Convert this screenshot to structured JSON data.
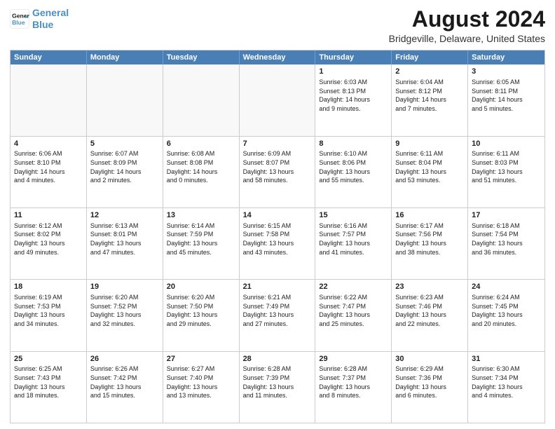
{
  "header": {
    "logo_line1": "General",
    "logo_line2": "Blue",
    "main_title": "August 2024",
    "subtitle": "Bridgeville, Delaware, United States"
  },
  "calendar": {
    "days": [
      "Sunday",
      "Monday",
      "Tuesday",
      "Wednesday",
      "Thursday",
      "Friday",
      "Saturday"
    ],
    "weeks": [
      [
        {
          "day": "",
          "info": "",
          "empty": true
        },
        {
          "day": "",
          "info": "",
          "empty": true
        },
        {
          "day": "",
          "info": "",
          "empty": true
        },
        {
          "day": "",
          "info": "",
          "empty": true
        },
        {
          "day": "1",
          "info": "Sunrise: 6:03 AM\nSunset: 8:13 PM\nDaylight: 14 hours\nand 9 minutes.",
          "empty": false
        },
        {
          "day": "2",
          "info": "Sunrise: 6:04 AM\nSunset: 8:12 PM\nDaylight: 14 hours\nand 7 minutes.",
          "empty": false
        },
        {
          "day": "3",
          "info": "Sunrise: 6:05 AM\nSunset: 8:11 PM\nDaylight: 14 hours\nand 5 minutes.",
          "empty": false
        }
      ],
      [
        {
          "day": "4",
          "info": "Sunrise: 6:06 AM\nSunset: 8:10 PM\nDaylight: 14 hours\nand 4 minutes.",
          "empty": false
        },
        {
          "day": "5",
          "info": "Sunrise: 6:07 AM\nSunset: 8:09 PM\nDaylight: 14 hours\nand 2 minutes.",
          "empty": false
        },
        {
          "day": "6",
          "info": "Sunrise: 6:08 AM\nSunset: 8:08 PM\nDaylight: 14 hours\nand 0 minutes.",
          "empty": false
        },
        {
          "day": "7",
          "info": "Sunrise: 6:09 AM\nSunset: 8:07 PM\nDaylight: 13 hours\nand 58 minutes.",
          "empty": false
        },
        {
          "day": "8",
          "info": "Sunrise: 6:10 AM\nSunset: 8:06 PM\nDaylight: 13 hours\nand 55 minutes.",
          "empty": false
        },
        {
          "day": "9",
          "info": "Sunrise: 6:11 AM\nSunset: 8:04 PM\nDaylight: 13 hours\nand 53 minutes.",
          "empty": false
        },
        {
          "day": "10",
          "info": "Sunrise: 6:11 AM\nSunset: 8:03 PM\nDaylight: 13 hours\nand 51 minutes.",
          "empty": false
        }
      ],
      [
        {
          "day": "11",
          "info": "Sunrise: 6:12 AM\nSunset: 8:02 PM\nDaylight: 13 hours\nand 49 minutes.",
          "empty": false
        },
        {
          "day": "12",
          "info": "Sunrise: 6:13 AM\nSunset: 8:01 PM\nDaylight: 13 hours\nand 47 minutes.",
          "empty": false
        },
        {
          "day": "13",
          "info": "Sunrise: 6:14 AM\nSunset: 7:59 PM\nDaylight: 13 hours\nand 45 minutes.",
          "empty": false
        },
        {
          "day": "14",
          "info": "Sunrise: 6:15 AM\nSunset: 7:58 PM\nDaylight: 13 hours\nand 43 minutes.",
          "empty": false
        },
        {
          "day": "15",
          "info": "Sunrise: 6:16 AM\nSunset: 7:57 PM\nDaylight: 13 hours\nand 41 minutes.",
          "empty": false
        },
        {
          "day": "16",
          "info": "Sunrise: 6:17 AM\nSunset: 7:56 PM\nDaylight: 13 hours\nand 38 minutes.",
          "empty": false
        },
        {
          "day": "17",
          "info": "Sunrise: 6:18 AM\nSunset: 7:54 PM\nDaylight: 13 hours\nand 36 minutes.",
          "empty": false
        }
      ],
      [
        {
          "day": "18",
          "info": "Sunrise: 6:19 AM\nSunset: 7:53 PM\nDaylight: 13 hours\nand 34 minutes.",
          "empty": false
        },
        {
          "day": "19",
          "info": "Sunrise: 6:20 AM\nSunset: 7:52 PM\nDaylight: 13 hours\nand 32 minutes.",
          "empty": false
        },
        {
          "day": "20",
          "info": "Sunrise: 6:20 AM\nSunset: 7:50 PM\nDaylight: 13 hours\nand 29 minutes.",
          "empty": false
        },
        {
          "day": "21",
          "info": "Sunrise: 6:21 AM\nSunset: 7:49 PM\nDaylight: 13 hours\nand 27 minutes.",
          "empty": false
        },
        {
          "day": "22",
          "info": "Sunrise: 6:22 AM\nSunset: 7:47 PM\nDaylight: 13 hours\nand 25 minutes.",
          "empty": false
        },
        {
          "day": "23",
          "info": "Sunrise: 6:23 AM\nSunset: 7:46 PM\nDaylight: 13 hours\nand 22 minutes.",
          "empty": false
        },
        {
          "day": "24",
          "info": "Sunrise: 6:24 AM\nSunset: 7:45 PM\nDaylight: 13 hours\nand 20 minutes.",
          "empty": false
        }
      ],
      [
        {
          "day": "25",
          "info": "Sunrise: 6:25 AM\nSunset: 7:43 PM\nDaylight: 13 hours\nand 18 minutes.",
          "empty": false
        },
        {
          "day": "26",
          "info": "Sunrise: 6:26 AM\nSunset: 7:42 PM\nDaylight: 13 hours\nand 15 minutes.",
          "empty": false
        },
        {
          "day": "27",
          "info": "Sunrise: 6:27 AM\nSunset: 7:40 PM\nDaylight: 13 hours\nand 13 minutes.",
          "empty": false
        },
        {
          "day": "28",
          "info": "Sunrise: 6:28 AM\nSunset: 7:39 PM\nDaylight: 13 hours\nand 11 minutes.",
          "empty": false
        },
        {
          "day": "29",
          "info": "Sunrise: 6:28 AM\nSunset: 7:37 PM\nDaylight: 13 hours\nand 8 minutes.",
          "empty": false
        },
        {
          "day": "30",
          "info": "Sunrise: 6:29 AM\nSunset: 7:36 PM\nDaylight: 13 hours\nand 6 minutes.",
          "empty": false
        },
        {
          "day": "31",
          "info": "Sunrise: 6:30 AM\nSunset: 7:34 PM\nDaylight: 13 hours\nand 4 minutes.",
          "empty": false
        }
      ]
    ]
  }
}
